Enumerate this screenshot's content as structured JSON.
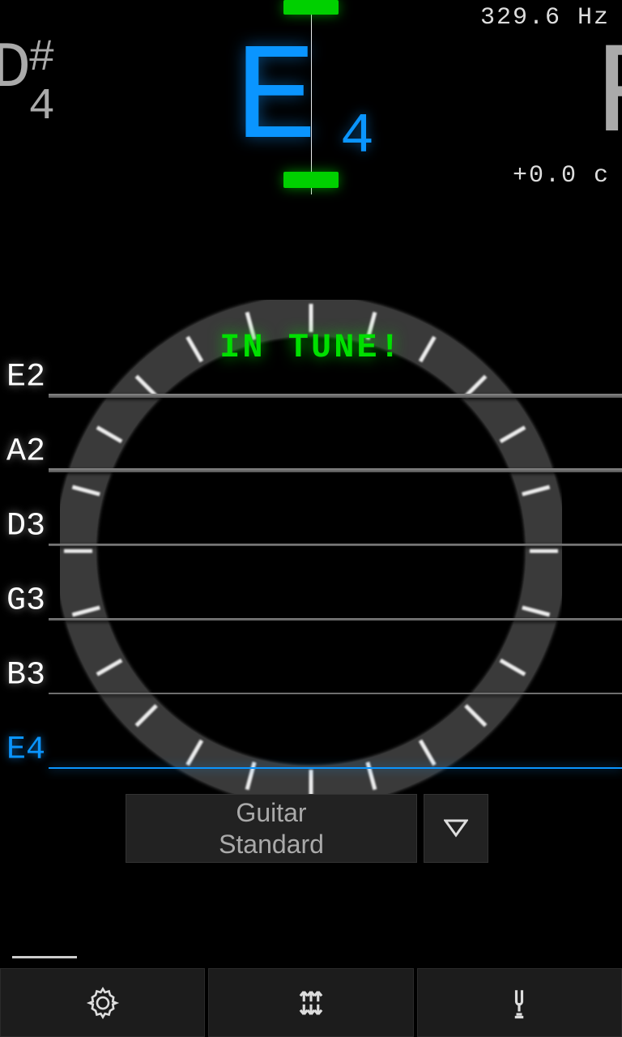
{
  "readout": {
    "frequency": "329.6 Hz",
    "cents": "+0.0 c"
  },
  "note": {
    "letter": "E",
    "octave": "4",
    "prev_letter": "D",
    "prev_sharp": "#",
    "prev_octave": "4",
    "next_letter": "F"
  },
  "status": {
    "in_tune": "IN TUNE!"
  },
  "strings": [
    {
      "label": "E2",
      "active": false
    },
    {
      "label": "A2",
      "active": false
    },
    {
      "label": "D3",
      "active": false
    },
    {
      "label": "G3",
      "active": false
    },
    {
      "label": "B3",
      "active": false
    },
    {
      "label": "E4",
      "active": true
    }
  ],
  "tuning": {
    "line1": "Guitar",
    "line2": "Standard"
  },
  "colors": {
    "accent_blue": "#0a95ff",
    "accent_green": "#00e000",
    "bg": "#000000"
  }
}
